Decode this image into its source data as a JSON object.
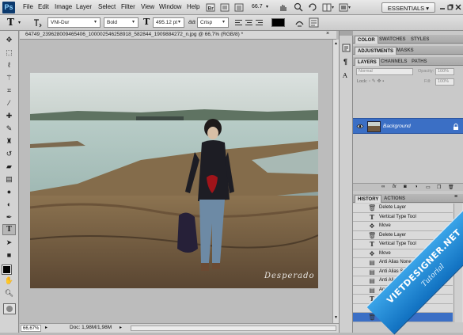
{
  "app": {
    "logo": "Ps",
    "workspace": "ESSENTIALS",
    "workspace_menu": "▾"
  },
  "menu": [
    "File",
    "Edit",
    "Image",
    "Layer",
    "Select",
    "Filter",
    "View",
    "Window",
    "Help"
  ],
  "app_bar": {
    "zoom": "66.7",
    "zoom_menu": "▾"
  },
  "options": {
    "tool_glyph": "T",
    "font_family": "VNI-Dur",
    "font_style": "Bold",
    "font_size": "495.12 pt",
    "size_glyph": "T",
    "aa_label": "aa",
    "anti_alias": "Crisp",
    "text_color": "#000000"
  },
  "document": {
    "title": "64749_239628009465406_100002546258918_582844_1909884272_n.jpg @ 66,7% (RGB/8) *",
    "watermark": "Desperado"
  },
  "statusbar": {
    "zoom": "66,67%",
    "doc": "Doc: 1,98M/1,98M"
  },
  "panels": {
    "color_group": [
      "COLOR",
      "SWATCHES",
      "STYLES"
    ],
    "adjust_group": [
      "ADJUSTMENTS",
      "MASKS"
    ],
    "layers_group": [
      "LAYERS",
      "CHANNELS",
      "PATHS"
    ],
    "blend_mode": "Normal",
    "opacity_label": "Opacity:",
    "opacity_value": "100%",
    "lock_label": "Lock:",
    "fill_label": "Fill:",
    "fill_value": "100%",
    "layer_name": "Background",
    "history_group": [
      "HISTORY",
      "ACTIONS"
    ]
  },
  "history": [
    {
      "label": "Delete Layer",
      "icon": "trash-icon"
    },
    {
      "label": "Vertical Type Tool",
      "icon": "type-icon"
    },
    {
      "label": "Move",
      "icon": "move-icon"
    },
    {
      "label": "Delete Layer",
      "icon": "trash-icon"
    },
    {
      "label": "Vertical Type Tool",
      "icon": "type-icon"
    },
    {
      "label": "Move",
      "icon": "move-icon"
    },
    {
      "label": "Anti Alias None",
      "icon": "text-settings-icon"
    },
    {
      "label": "Anti Alias Smooth",
      "icon": "text-settings-icon"
    },
    {
      "label": "Anti Alias Strong",
      "icon": "text-settings-icon"
    },
    {
      "label": "Anti Alias Crisp",
      "icon": "text-settings-icon"
    },
    {
      "label": "Vertical Type Tool",
      "icon": "type-icon"
    },
    {
      "label": "Delete Layer",
      "icon": "trash-icon"
    },
    {
      "label": "Delete Layer",
      "icon": "trash-icon"
    }
  ],
  "ribbon": {
    "title": "VIETDESIGNER.NET",
    "subtitle": "Tutorial"
  },
  "colors": {
    "accent": "#3b6fc5",
    "ribbon": "#1a86d6"
  }
}
